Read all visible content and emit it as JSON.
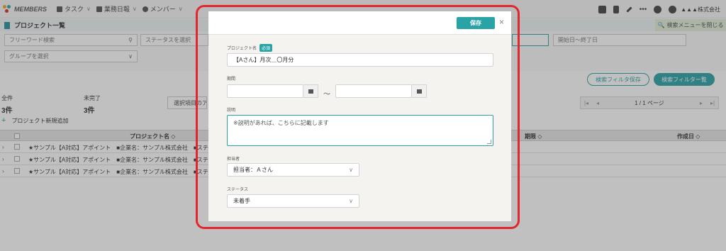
{
  "app": {
    "logo_text": "MEMBERS",
    "nav": [
      {
        "label": "タスク"
      },
      {
        "label": "業務日報"
      },
      {
        "label": "メンバー"
      }
    ],
    "company": "▲▲▲株式会社"
  },
  "page": {
    "title": "プロジェクト一覧",
    "search_menu_close": "検索メニューを閉じる"
  },
  "filters": {
    "freeword_placeholder": "フリーワード検索",
    "status_placeholder": "ステータスを選択",
    "group_placeholder": "グループを選択",
    "date_range_placeholder": "開始日〜終了日",
    "save_filter_label": "検索フィルタ保存",
    "filter_list_label": "検索フィルター覧"
  },
  "summary": {
    "all_label": "全件",
    "all_count": "3件",
    "incomplete_label": "未完了",
    "incomplete_count": "3件",
    "bulk_action_label": "選択項目のアクション"
  },
  "pager": {
    "info": "1 / 1 ページ"
  },
  "add_project_label": "プロジェクト新規追加",
  "table": {
    "columns": {
      "project_name": "プロジェクト名 ◇",
      "deadline": "期限 ◇",
      "created": "作成日 ◇"
    },
    "rows": [
      {
        "name": "★サンプル【A対応】アポイント　■企業名：サンプル株式会社　■ステータス：ヨミ"
      },
      {
        "name": "★サンプル【A対応】アポイント　■企業名：サンプル株式会社　■ステータス：ヨミ"
      },
      {
        "name": "★サンプル【A対応】アポイント　■企業名：サンプル株式会社　■ステータス：ヨミ"
      }
    ]
  },
  "modal": {
    "save_label": "保存",
    "close_icon": "×",
    "project_name_label": "プロジェクト名",
    "required_badge": "必須",
    "project_name_value": "【Aさん】月次＿〇月分",
    "period_label": "期間",
    "period_separator": "〜",
    "description_label": "説明",
    "description_placeholder": "※説明があれば、こちらに記載します",
    "assignee_label": "担当者",
    "assignee_value": "担当者：Ａさん",
    "status_label": "ステータス",
    "status_value": "未着手"
  },
  "colors": {
    "accent": "#2aa3a7",
    "highlight": "#e3262d"
  }
}
